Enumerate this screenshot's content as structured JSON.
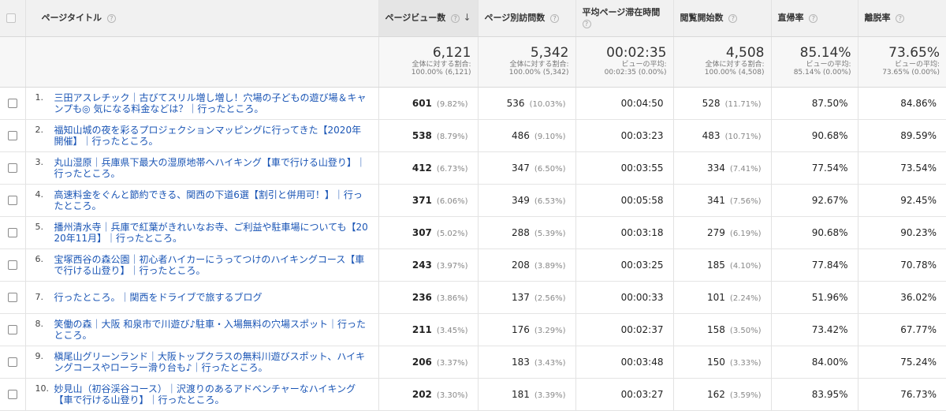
{
  "columns": {
    "title": "ページタイトル",
    "pageviews": "ページビュー数",
    "unique_pageviews": "ページ別訪問数",
    "avg_time": "平均ページ滞在時間",
    "entrances": "閲覧開始数",
    "bounce_rate": "直帰率",
    "exit_rate": "離脱率"
  },
  "help_glyph": "?",
  "sort_glyph": "↓",
  "totals": {
    "pageviews": {
      "value": "6,121",
      "sub1": "全体に対する割合:",
      "sub2": "100.00% (6,121)"
    },
    "unique_pageviews": {
      "value": "5,342",
      "sub1": "全体に対する割合:",
      "sub2": "100.00% (5,342)"
    },
    "avg_time": {
      "value": "00:02:35",
      "sub1": "ビューの平均:",
      "sub2": "00:02:35 (0.00%)"
    },
    "entrances": {
      "value": "4,508",
      "sub1": "全体に対する割合:",
      "sub2": "100.00% (4,508)"
    },
    "bounce_rate": {
      "value": "85.14%",
      "sub1": "ビューの平均:",
      "sub2": "85.14% (0.00%)"
    },
    "exit_rate": {
      "value": "73.65%",
      "sub1": "ビューの平均:",
      "sub2": "73.65% (0.00%)"
    }
  },
  "rows": [
    {
      "rank": "1.",
      "title": "三田アスレチック｜古びてスリル増し増し！穴場の子どもの遊び場＆キャンプも◎ 気になる料金などは？｜行ったところ。",
      "pv": "601",
      "pv_pct": "(9.82%)",
      "upv": "536",
      "upv_pct": "(10.03%)",
      "avg": "00:04:50",
      "ent": "528",
      "ent_pct": "(11.71%)",
      "bounce": "87.50%",
      "exit": "84.86%"
    },
    {
      "rank": "2.",
      "title": "福知山城の夜を彩るプロジェクションマッピングに行ってきた【2020年開催】｜行ったところ。",
      "pv": "538",
      "pv_pct": "(8.79%)",
      "upv": "486",
      "upv_pct": "(9.10%)",
      "avg": "00:03:23",
      "ent": "483",
      "ent_pct": "(10.71%)",
      "bounce": "90.68%",
      "exit": "89.59%"
    },
    {
      "rank": "3.",
      "title": "丸山湿原｜兵庫県下最大の湿原地帯へハイキング【車で行ける山登り】｜行ったところ。",
      "pv": "412",
      "pv_pct": "(6.73%)",
      "upv": "347",
      "upv_pct": "(6.50%)",
      "avg": "00:03:55",
      "ent": "334",
      "ent_pct": "(7.41%)",
      "bounce": "77.54%",
      "exit": "73.54%"
    },
    {
      "rank": "4.",
      "title": "高速料金をぐんと節約できる、関西の下道6選【割引と併用可！】｜行ったところ。",
      "pv": "371",
      "pv_pct": "(6.06%)",
      "upv": "349",
      "upv_pct": "(6.53%)",
      "avg": "00:05:58",
      "ent": "341",
      "ent_pct": "(7.56%)",
      "bounce": "92.67%",
      "exit": "92.45%"
    },
    {
      "rank": "5.",
      "title": "播州清水寺｜兵庫で紅葉がきれいなお寺、ご利益や駐車場についても【2020年11月】｜行ったところ。",
      "pv": "307",
      "pv_pct": "(5.02%)",
      "upv": "288",
      "upv_pct": "(5.39%)",
      "avg": "00:03:18",
      "ent": "279",
      "ent_pct": "(6.19%)",
      "bounce": "90.68%",
      "exit": "90.23%"
    },
    {
      "rank": "6.",
      "title": "宝塚西谷の森公園｜初心者ハイカーにうってつけのハイキングコース【車で行ける山登り】｜行ったところ。",
      "pv": "243",
      "pv_pct": "(3.97%)",
      "upv": "208",
      "upv_pct": "(3.89%)",
      "avg": "00:03:25",
      "ent": "185",
      "ent_pct": "(4.10%)",
      "bounce": "77.84%",
      "exit": "70.78%"
    },
    {
      "rank": "7.",
      "title": "行ったところ。｜関西をドライブで旅するブログ",
      "pv": "236",
      "pv_pct": "(3.86%)",
      "upv": "137",
      "upv_pct": "(2.56%)",
      "avg": "00:00:33",
      "ent": "101",
      "ent_pct": "(2.24%)",
      "bounce": "51.96%",
      "exit": "36.02%"
    },
    {
      "rank": "8.",
      "title": "笑働の森｜大阪 和泉市で川遊び♪駐車・入場無料の穴場スポット｜行ったところ。",
      "pv": "211",
      "pv_pct": "(3.45%)",
      "upv": "176",
      "upv_pct": "(3.29%)",
      "avg": "00:02:37",
      "ent": "158",
      "ent_pct": "(3.50%)",
      "bounce": "73.42%",
      "exit": "67.77%"
    },
    {
      "rank": "9.",
      "title": "槇尾山グリーンランド｜大阪トップクラスの無料川遊びスポット、ハイキングコースやローラー滑り台も♪｜行ったところ。",
      "pv": "206",
      "pv_pct": "(3.37%)",
      "upv": "183",
      "upv_pct": "(3.43%)",
      "avg": "00:03:48",
      "ent": "150",
      "ent_pct": "(3.33%)",
      "bounce": "84.00%",
      "exit": "75.24%"
    },
    {
      "rank": "10.",
      "title": "妙見山（初谷渓谷コース）｜沢渡りのあるアドベンチャーなハイキング【車で行ける山登り】｜行ったところ。",
      "pv": "202",
      "pv_pct": "(3.30%)",
      "upv": "181",
      "upv_pct": "(3.39%)",
      "avg": "00:03:27",
      "ent": "162",
      "ent_pct": "(3.59%)",
      "bounce": "83.95%",
      "exit": "76.73%"
    }
  ]
}
